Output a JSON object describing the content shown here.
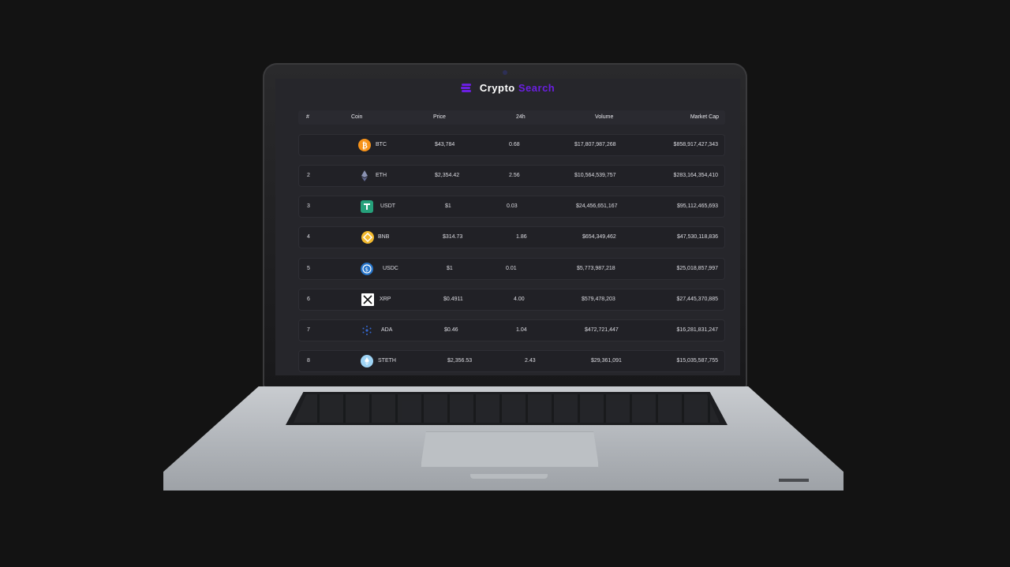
{
  "app": {
    "brand_first": "Crypto",
    "brand_second": "Search",
    "accent_color": "#6a1fe0"
  },
  "table": {
    "headers": [
      "#",
      "Coin",
      "Price",
      "24h",
      "Volume",
      "Market Cap"
    ],
    "rows": [
      {
        "rank": "",
        "symbol": "BTC",
        "icon": "bitcoin-icon",
        "icon_color": "#f7931a",
        "price": "$43,784",
        "change": "0.68",
        "volume": "$17,807,987,268",
        "market_cap": "$858,917,427,343"
      },
      {
        "rank": "2",
        "symbol": "ETH",
        "icon": "ethereum-icon",
        "icon_color": "#8a92b2",
        "price": "$2,354.42",
        "change": "2.56",
        "volume": "$10,564,539,757",
        "market_cap": "$283,164,354,410"
      },
      {
        "rank": "3",
        "symbol": "USDT",
        "icon": "tether-icon",
        "icon_color": "#26a17b",
        "price": "$1",
        "change": "0.03",
        "volume": "$24,456,651,167",
        "market_cap": "$95,112,465,693"
      },
      {
        "rank": "4",
        "symbol": "BNB",
        "icon": "bnb-icon",
        "icon_color": "#f3ba2f",
        "price": "$314.73",
        "change": "1.86",
        "volume": "$654,349,462",
        "market_cap": "$47,530,118,836"
      },
      {
        "rank": "5",
        "symbol": "USDC",
        "icon": "usdc-icon",
        "icon_color": "#2775ca",
        "price": "$1",
        "change": "0.01",
        "volume": "$5,773,987,218",
        "market_cap": "$25,018,857,997"
      },
      {
        "rank": "6",
        "symbol": "XRP",
        "icon": "xrp-icon",
        "icon_color": "#ffffff",
        "price": "$0.4911",
        "change": "4.00",
        "volume": "$579,478,203",
        "market_cap": "$27,445,370,885"
      },
      {
        "rank": "7",
        "symbol": "ADA",
        "icon": "cardano-icon",
        "icon_color": "#3468d1",
        "price": "$0.46",
        "change": "1.04",
        "volume": "$472,721,447",
        "market_cap": "$16,281,831,247"
      },
      {
        "rank": "8",
        "symbol": "STETH",
        "icon": "steth-icon",
        "icon_color": "#9fd4f5",
        "price": "$2,356.53",
        "change": "2.43",
        "volume": "$29,361,091",
        "market_cap": "$15,035,587,755"
      }
    ]
  }
}
